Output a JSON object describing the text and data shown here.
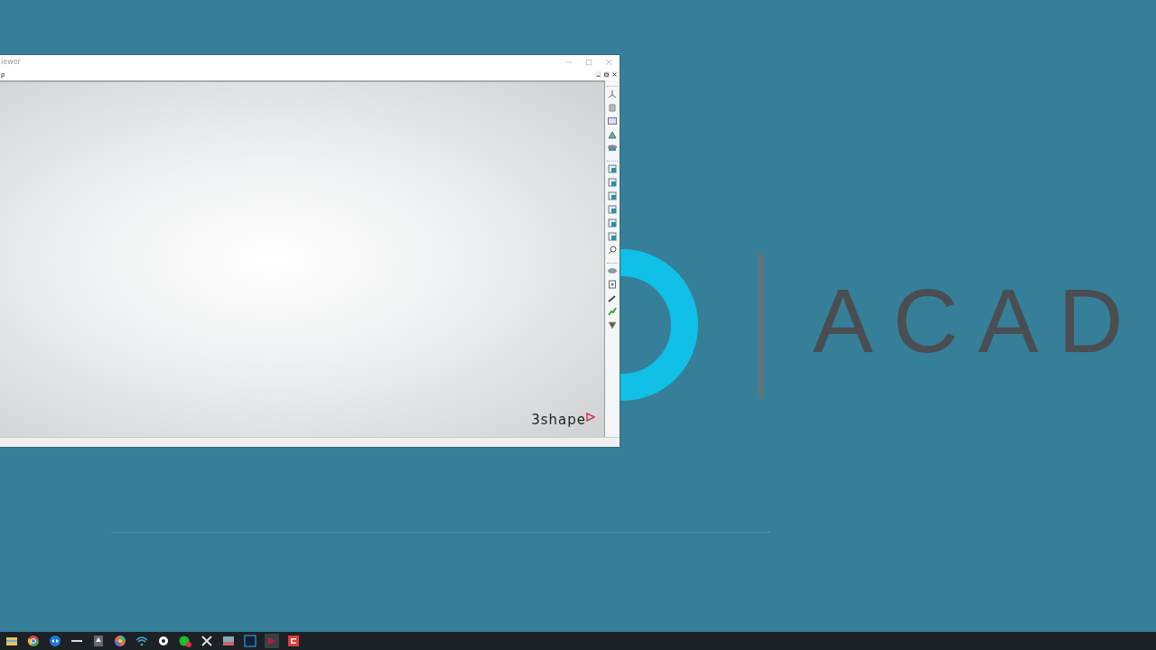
{
  "window": {
    "title": "iewer",
    "menu": [
      "p"
    ],
    "logo": "3shape"
  },
  "wallpaper": {
    "text": "ACAD"
  }
}
